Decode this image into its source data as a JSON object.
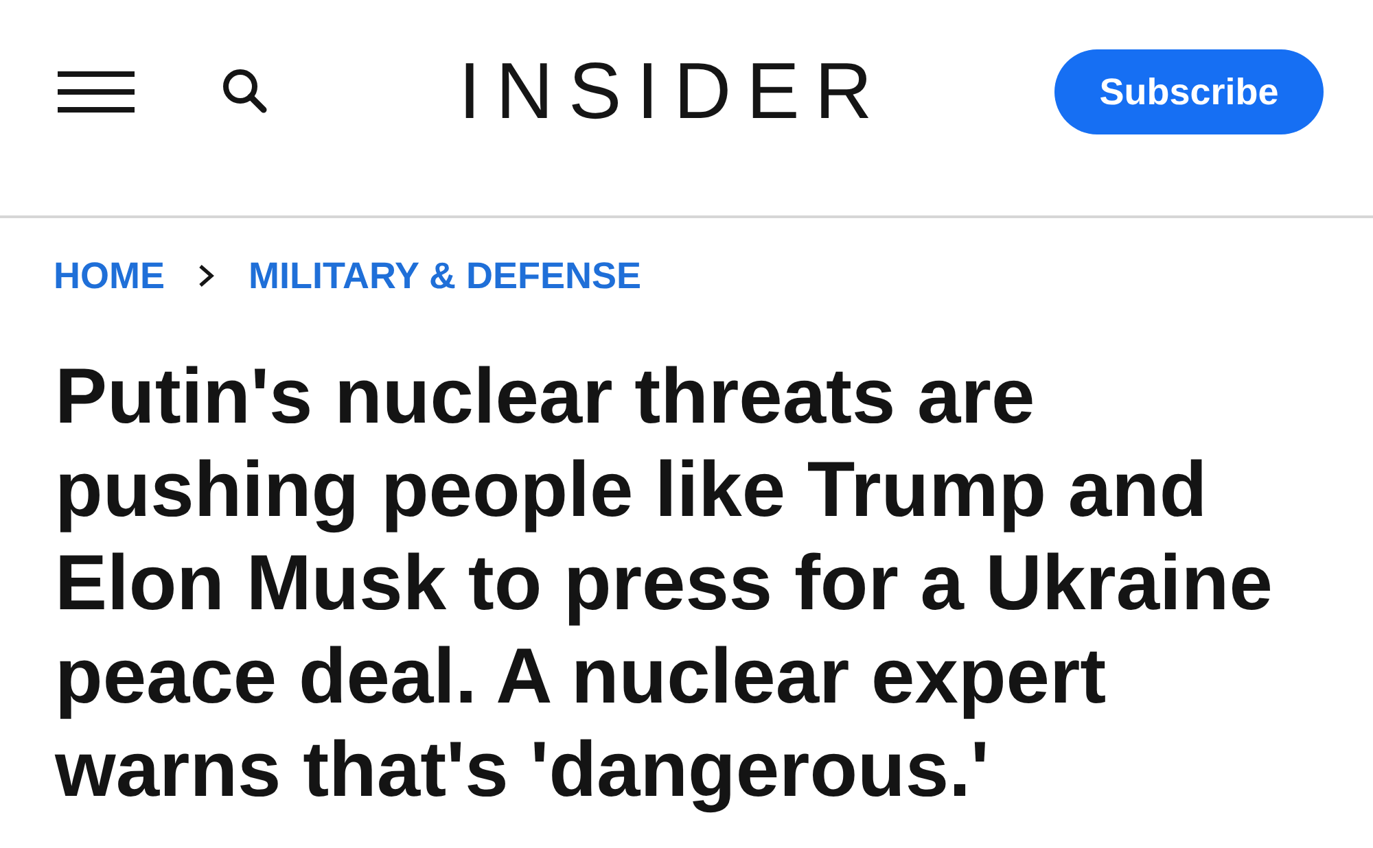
{
  "header": {
    "logo": "INSIDER",
    "subscribe_button": "Subscribe"
  },
  "breadcrumb": [
    "HOME",
    "MILITARY & DEFENSE"
  ],
  "headline": "Putin's nuclear threats are pushing people like Trump and Elon Musk to press for a Ukraine peace deal. A nuclear expert warns that's 'dangerous.'"
}
